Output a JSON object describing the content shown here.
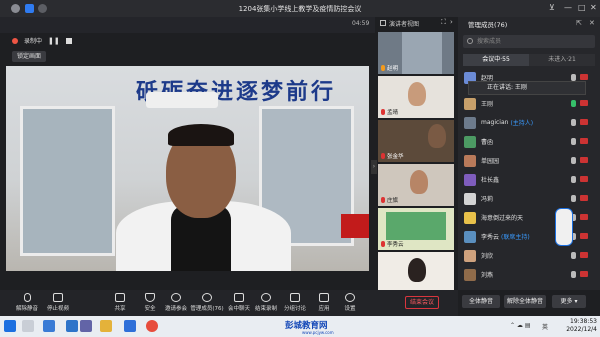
{
  "window": {
    "title": "1204张集小学线上教学及疫情防控会议",
    "timer": "04:59"
  },
  "toolbar_top": {
    "recording": "录制中",
    "lock_view": "锁定画面"
  },
  "video": {
    "banner": "砥砺奋进逐梦前行"
  },
  "thumbs": {
    "mode": "演讲者视图",
    "items": [
      {
        "name": "赵明"
      },
      {
        "name": "孟晴"
      },
      {
        "name": "张金华"
      },
      {
        "name": "庄旗"
      },
      {
        "name": "李秀云"
      },
      {
        "name": ""
      }
    ]
  },
  "panel": {
    "title": "管理成员(76)",
    "search_placeholder": "搜索成员",
    "tab_in": "会议中·55",
    "tab_out": "未进入·21",
    "speaking": "正在讲话: 王刚",
    "members": [
      {
        "name": "赵明",
        "tag": "",
        "avatar": "#6b8bd6"
      },
      {
        "name": "王刚",
        "tag": "",
        "avatar": "#c8a06a"
      },
      {
        "name": "magician",
        "tag": "(主持人)",
        "avatar": "#6d7b8c"
      },
      {
        "name": "曹函",
        "tag": "",
        "avatar": "#4c9a63"
      },
      {
        "name": "单园园",
        "tag": "",
        "avatar": "#b97a5a"
      },
      {
        "name": "杜长鑫",
        "tag": "",
        "avatar": "#7f5dbd"
      },
      {
        "name": "冯莉",
        "tag": "",
        "avatar": "#d3d3d3"
      },
      {
        "name": "海意倒过来的天",
        "tag": "",
        "avatar": "#e8c14a"
      },
      {
        "name": "李秀云",
        "tag": "(联席主持)",
        "avatar": "#5a8fbf"
      },
      {
        "name": "刘欣",
        "tag": "",
        "avatar": "#cfa27e"
      },
      {
        "name": "刘燕",
        "tag": "",
        "avatar": "#8f6b4a"
      }
    ]
  },
  "controls": {
    "buttons": [
      "解除静音",
      "停止视频",
      "共享",
      "安全",
      "邀请参会",
      "管理成员(76)",
      "会中聊天",
      "结束录制",
      "分组讨论",
      "应用",
      "设置"
    ],
    "end_meeting": "结束会议",
    "mute_all": "全体静音",
    "unmute_all": "解除全体静音",
    "more": "更多"
  },
  "taskbar": {
    "brand": "彭城教育网",
    "brand_url": "www.pcjyw.com",
    "time": "19:38:53",
    "date": "2022/12/4",
    "lang": "英"
  }
}
